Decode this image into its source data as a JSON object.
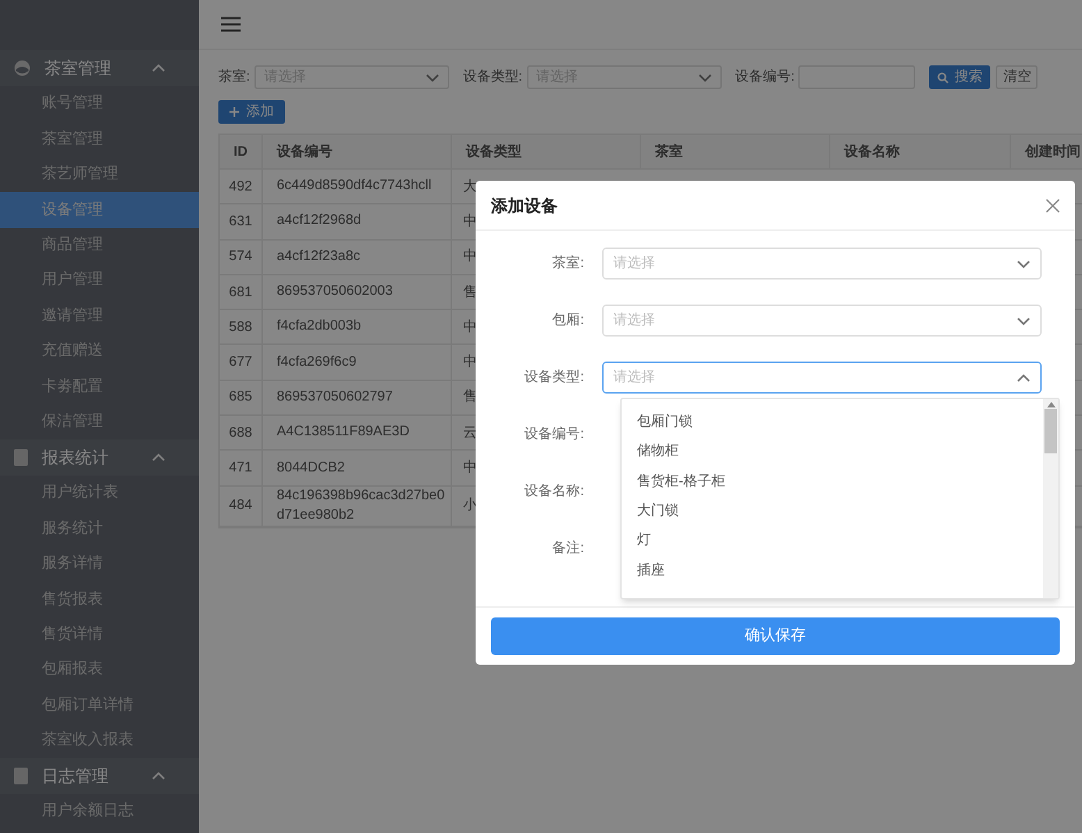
{
  "sidebar": {
    "groups": [
      {
        "title": "茶室管理",
        "expanded": true,
        "items": [
          {
            "label": "账号管理",
            "selected": false
          },
          {
            "label": "茶室管理",
            "selected": false
          },
          {
            "label": "茶艺师管理",
            "selected": false
          },
          {
            "label": "设备管理",
            "selected": true
          },
          {
            "label": "商品管理",
            "selected": false
          },
          {
            "label": "用户管理",
            "selected": false
          },
          {
            "label": "邀请管理",
            "selected": false
          },
          {
            "label": "充值赠送",
            "selected": false
          },
          {
            "label": "卡劵配置",
            "selected": false
          },
          {
            "label": "保洁管理",
            "selected": false
          }
        ]
      },
      {
        "title": "报表统计",
        "expanded": true,
        "items": [
          {
            "label": "用户统计表",
            "selected": false
          },
          {
            "label": "服务统计",
            "selected": false
          },
          {
            "label": "服务详情",
            "selected": false
          },
          {
            "label": "售货报表",
            "selected": false
          },
          {
            "label": "售货详情",
            "selected": false
          },
          {
            "label": "包厢报表",
            "selected": false
          },
          {
            "label": "包厢订单详情",
            "selected": false
          },
          {
            "label": "茶室收入报表",
            "selected": false
          }
        ]
      },
      {
        "title": "日志管理",
        "expanded": true,
        "items": [
          {
            "label": "用户余额日志",
            "selected": false
          }
        ]
      }
    ]
  },
  "filters": [
    {
      "label": "茶室:",
      "kind": "select",
      "placeholder": "请选择"
    },
    {
      "label": "设备类型:",
      "kind": "select",
      "placeholder": "请选择"
    },
    {
      "label": "设备编号:",
      "kind": "input"
    }
  ],
  "search_button": "搜索",
  "clear_button": "清空",
  "add_button": "添加",
  "table": {
    "columns": [
      "ID",
      "设备编号",
      "设备类型",
      "茶室",
      "设备名称",
      "创建时间"
    ],
    "rows": [
      {
        "id": "492",
        "code": "6c449d8590df4c7743hcll",
        "type": "大"
      },
      {
        "id": "631",
        "code": "a4cf12f2968d",
        "type": "中"
      },
      {
        "id": "574",
        "code": "a4cf12f23a8c",
        "type": "中"
      },
      {
        "id": "681",
        "code": "869537050602003",
        "type": "售"
      },
      {
        "id": "588",
        "code": "f4cfa2db003b",
        "type": "中"
      },
      {
        "id": "677",
        "code": "f4cfa269f6c9",
        "type": "中"
      },
      {
        "id": "685",
        "code": "869537050602797",
        "type": "售"
      },
      {
        "id": "688",
        "code": "A4C138511F89AE3D",
        "type": "云"
      },
      {
        "id": "471",
        "code": "8044DCB2",
        "type": "中"
      },
      {
        "id": "484",
        "code": "84c196398b96cac3d27be0d71ee980b2",
        "type": "小"
      }
    ]
  },
  "dialog": {
    "title": "添加设备",
    "fields": [
      {
        "label": "茶室:",
        "kind": "select",
        "placeholder": "请选择",
        "open": false
      },
      {
        "label": "包厢:",
        "kind": "select",
        "placeholder": "请选择",
        "open": false
      },
      {
        "label": "设备类型:",
        "kind": "select",
        "placeholder": "请选择",
        "open": true
      },
      {
        "label": "设备编号:",
        "kind": "hidden"
      },
      {
        "label": "设备名称:",
        "kind": "hidden"
      },
      {
        "label": "备注:",
        "kind": "hidden"
      }
    ],
    "options": [
      "包厢门锁",
      "储物柜",
      "售货柜-格子柜",
      "大门锁",
      "灯",
      "插座"
    ],
    "save_button": "确认保存"
  }
}
